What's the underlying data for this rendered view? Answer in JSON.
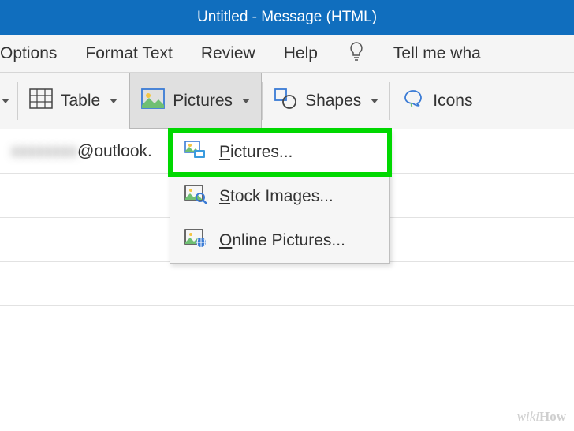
{
  "title": "Untitled  -  Message (HTML)",
  "tabs": {
    "options": "Options",
    "format_text": "Format Text",
    "review": "Review",
    "help": "Help",
    "tell_me": "Tell me wha"
  },
  "ribbon": {
    "table": "Table",
    "pictures": "Pictures",
    "shapes": "Shapes",
    "icons": "Icons"
  },
  "dropdown": {
    "pictures": "Pictures...",
    "stock": "Stock Images...",
    "online": "Online Pictures..."
  },
  "email_row": {
    "blurred": "xxxxxxxx",
    "visible": "@outlook."
  },
  "watermark": "wikiHow"
}
